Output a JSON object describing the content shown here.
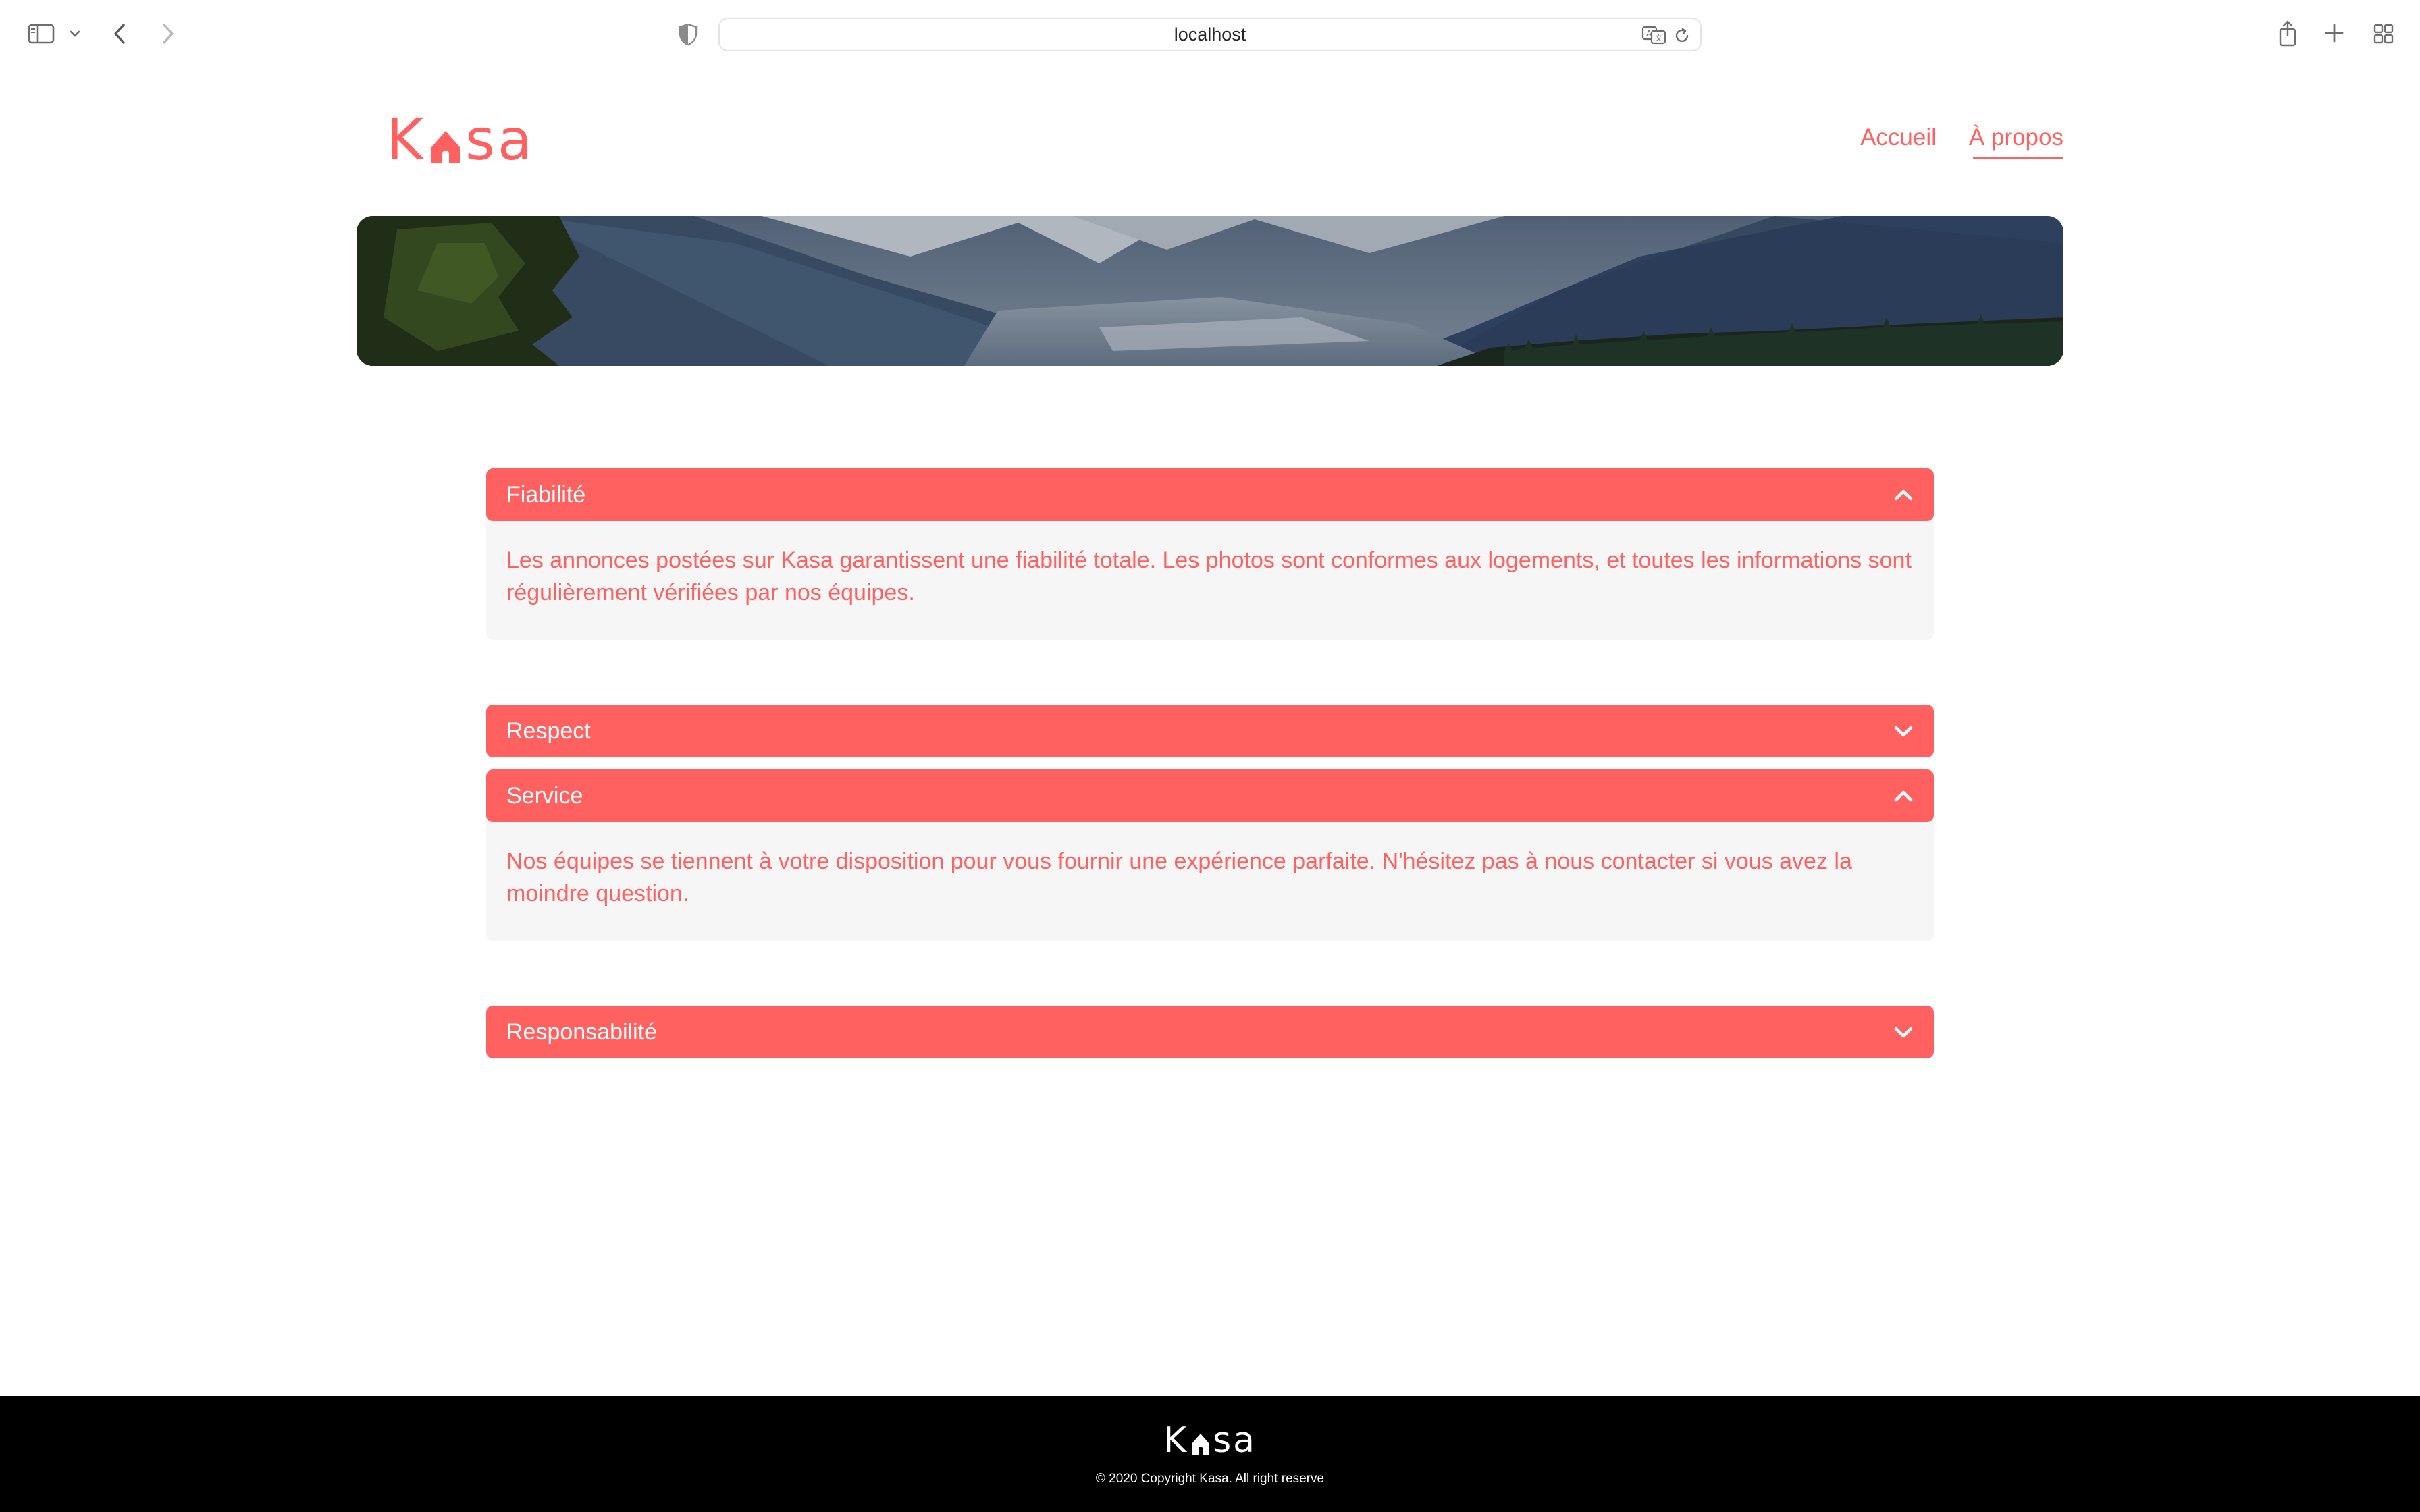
{
  "browser": {
    "url": "localhost",
    "icons": [
      "sidebar-icon",
      "chevron-down-icon",
      "back-icon",
      "forward-icon",
      "shield-icon",
      "translate-icon",
      "reload-icon",
      "share-icon",
      "new-tab-icon",
      "tab-overview-icon"
    ]
  },
  "header": {
    "logo": {
      "left": "K",
      "right": "sa"
    },
    "nav": [
      {
        "label": "Accueil",
        "active": false
      },
      {
        "label": "À propos",
        "active": true
      }
    ]
  },
  "colors": {
    "accent": "#FF6060",
    "body_bg": "#F6F6F6",
    "footer_bg": "#000000"
  },
  "collapses": [
    {
      "title": "Fiabilité",
      "open": true,
      "content": "Les annonces postées sur Kasa garantissent une fiabilité totale. Les photos sont conformes aux logements, et toutes les informations sont régulièrement vérifiées par nos équipes."
    },
    {
      "title": "Respect",
      "open": false
    },
    {
      "title": "Service",
      "open": true,
      "content": "Nos équipes se tiennent à votre disposition pour vous fournir une expérience parfaite. N'hésitez pas à nous contacter si vous avez la moindre question."
    },
    {
      "title": "Responsabilité",
      "open": false
    }
  ],
  "footer": {
    "logo": {
      "left": "K",
      "right": "sa"
    },
    "copyright": "© 2020 Copyright Kasa. All right reserve"
  }
}
